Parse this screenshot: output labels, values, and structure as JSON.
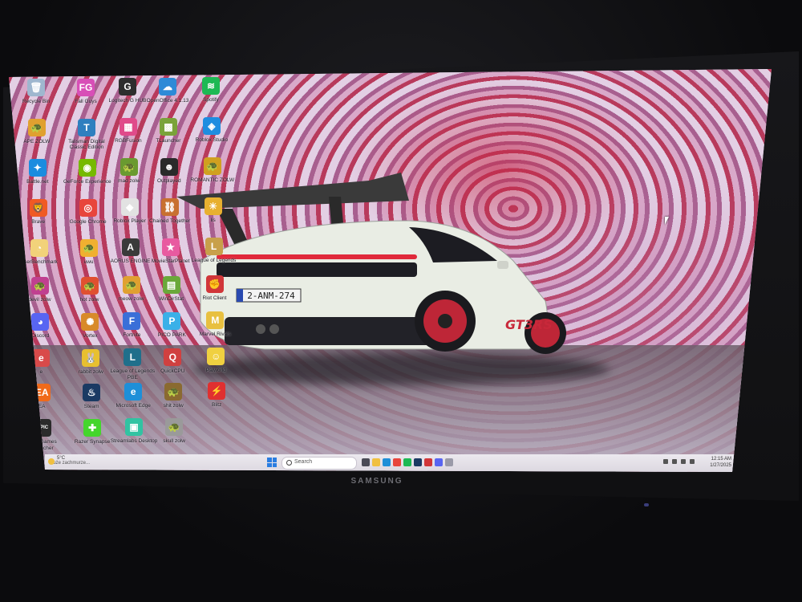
{
  "monitor": {
    "brand": "SAMSUNG"
  },
  "wallpaper": {
    "license_plate": "2-ANM-274",
    "badge": "GT3RS",
    "car_body_color": "#e9ede4",
    "wheel_color": "#d0283a"
  },
  "desktop_icons": [
    {
      "label": "Recycle Bin",
      "icon": "recycle-bin-icon",
      "color": "#9fb7cf",
      "glyph": "🗑"
    },
    {
      "label": "APE ZOLW",
      "icon": "turtle-icon",
      "color": "#e0a030",
      "glyph": "🐢"
    },
    {
      "label": "Battle.net",
      "icon": "battlenet-icon",
      "color": "#1b8cdf",
      "glyph": "✦"
    },
    {
      "label": "Brave",
      "icon": "brave-icon",
      "color": "#f05a24",
      "glyph": "🦁"
    },
    {
      "label": "UserBenchmark",
      "icon": "benchmark-icon",
      "color": "#f2d27a",
      "glyph": "◔"
    },
    {
      "label": "devil zolw",
      "icon": "turtle-icon",
      "color": "#c04090",
      "glyph": "🐢"
    },
    {
      "label": "Discord",
      "icon": "discord-icon",
      "color": "#5865f2",
      "glyph": "◕"
    },
    {
      "label": "e",
      "icon": "app-icon",
      "color": "#d94a4a",
      "glyph": "e"
    },
    {
      "label": "EA",
      "icon": "ea-icon",
      "color": "#f06a1a",
      "glyph": "EA"
    },
    {
      "label": "Epic Games Launcher",
      "icon": "epic-games-icon",
      "color": "#2b2b2b",
      "glyph": "EPIC"
    },
    {
      "label": "Fall Guys",
      "icon": "fall-guys-icon",
      "color": "#d84fb7",
      "glyph": "FG"
    },
    {
      "label": "Talisman Digital Classic Edition",
      "icon": "talisman-icon",
      "color": "#2f7fbf",
      "glyph": "T"
    },
    {
      "label": "GeForce Experience",
      "icon": "nvidia-icon",
      "color": "#76b900",
      "glyph": "◉"
    },
    {
      "label": "Google Chrome",
      "icon": "chrome-icon",
      "color": "#e8453c",
      "glyph": "◎"
    },
    {
      "label": "uwu",
      "icon": "turtle-icon",
      "color": "#f0b030",
      "glyph": "🐢"
    },
    {
      "label": "hot zolw",
      "icon": "turtle-icon",
      "color": "#e05030",
      "glyph": "🐢"
    },
    {
      "label": "Vortex",
      "icon": "vortex-icon",
      "color": "#d88a2a",
      "glyph": "✺"
    },
    {
      "label": "rabbit zolw",
      "icon": "turtle-icon",
      "color": "#e8c030",
      "glyph": "🐰"
    },
    {
      "label": "Steam",
      "icon": "steam-icon",
      "color": "#1b3a63",
      "glyph": "♨"
    },
    {
      "label": "Razer Synapse",
      "icon": "razer-icon",
      "color": "#44d62c",
      "glyph": "✚"
    },
    {
      "label": "Logitech G HUB",
      "icon": "logitech-icon",
      "color": "#2e2e2e",
      "glyph": "G"
    },
    {
      "label": "RGBFusion",
      "icon": "rgb-fusion-icon",
      "color": "#e04a8a",
      "glyph": "▦"
    },
    {
      "label": "mad zolw",
      "icon": "turtle-icon",
      "color": "#6a9a30",
      "glyph": "🐢"
    },
    {
      "label": "Roblox Player",
      "icon": "roblox-icon",
      "color": "#e2e2e2",
      "glyph": "◆"
    },
    {
      "label": "AORUS ENGINE",
      "icon": "aorus-icon",
      "color": "#3a3a3a",
      "glyph": "A"
    },
    {
      "label": "meow zolw",
      "icon": "turtle-icon",
      "color": "#e0a030",
      "glyph": "🐢"
    },
    {
      "label": "Fortnite",
      "icon": "fortnite-icon",
      "color": "#3a6fd8",
      "glyph": "F"
    },
    {
      "label": "League of Legends PBE",
      "icon": "league-icon",
      "color": "#1f6f8b",
      "glyph": "L"
    },
    {
      "label": "Microsoft Edge",
      "icon": "edge-icon",
      "color": "#1e8fd8",
      "glyph": "e"
    },
    {
      "label": "Streamlabs Desktop",
      "icon": "streamlabs-icon",
      "color": "#31c3a2",
      "glyph": "▣"
    },
    {
      "label": "OpenOffice 4.1.13",
      "icon": "openoffice-icon",
      "color": "#2d8ad7",
      "glyph": "☁"
    },
    {
      "label": "TLauncher",
      "icon": "minecraft-icon",
      "color": "#7aa33a",
      "glyph": "▩"
    },
    {
      "label": "Outplayed",
      "icon": "outplayed-icon",
      "color": "#2a2a2a",
      "glyph": "☻"
    },
    {
      "label": "Chained Together",
      "icon": "chained-together-icon",
      "color": "#c87030",
      "glyph": "⛓"
    },
    {
      "label": "MovieStarPlanet",
      "icon": "moviestarplanet-icon",
      "color": "#e85aa0",
      "glyph": "★"
    },
    {
      "label": "WinDirStat",
      "icon": "windirstat-icon",
      "color": "#6aa83a",
      "glyph": "▤"
    },
    {
      "label": "PICO PARK",
      "icon": "pico-park-icon",
      "color": "#3ab0e8",
      "glyph": "P"
    },
    {
      "label": "QuickCPU",
      "icon": "quickcpu-icon",
      "color": "#d04040",
      "glyph": "Q"
    },
    {
      "label": "shit zolw",
      "icon": "turtle-icon",
      "color": "#8a6a30",
      "glyph": "🐢"
    },
    {
      "label": "skull zolw",
      "icon": "turtle-icon",
      "color": "#9a9a9a",
      "glyph": "🐢"
    },
    {
      "label": "Spotify",
      "icon": "spotify-icon",
      "color": "#1db954",
      "glyph": "≋"
    },
    {
      "label": "Roblox Studio",
      "icon": "roblox-studio-icon",
      "color": "#1e8de0",
      "glyph": "◈"
    },
    {
      "label": "ROMANTIC ZOLW",
      "icon": "turtle-icon",
      "color": "#d0a020",
      "glyph": "🐢"
    },
    {
      "label": "lis",
      "icon": "app-icon",
      "color": "#e8b030",
      "glyph": "☀"
    },
    {
      "label": "League of Legends",
      "icon": "league-icon",
      "color": "#c8a04a",
      "glyph": "L"
    },
    {
      "label": "Riot Client",
      "icon": "riot-client-icon",
      "color": "#d13639",
      "glyph": "✊"
    },
    {
      "label": "Marvel Rivals",
      "icon": "marvel-rivals-icon",
      "color": "#e8c040",
      "glyph": "M"
    },
    {
      "label": "Palworld",
      "icon": "palworld-icon",
      "color": "#f0d040",
      "glyph": "☺"
    },
    {
      "label": "Blitz",
      "icon": "blitz-icon",
      "color": "#e03030",
      "glyph": "⚡"
    }
  ],
  "taskbar": {
    "weather_temp": "5°C",
    "weather_desc": "Duże zachmurze...",
    "search_placeholder": "Search",
    "time": "12:15 AM",
    "date": "1/27/2025",
    "pinned_apps": [
      {
        "name": "task-view",
        "color": "#4a4a55"
      },
      {
        "name": "file-explorer",
        "color": "#f0c040"
      },
      {
        "name": "edge",
        "color": "#1e8fd8"
      },
      {
        "name": "chrome",
        "color": "#e8453c"
      },
      {
        "name": "spotify",
        "color": "#1db954"
      },
      {
        "name": "steam",
        "color": "#1b3a63"
      },
      {
        "name": "riot-client",
        "color": "#d13639"
      },
      {
        "name": "discord",
        "color": "#5865f2"
      },
      {
        "name": "steam-helper",
        "color": "#9a9aa8"
      }
    ]
  }
}
